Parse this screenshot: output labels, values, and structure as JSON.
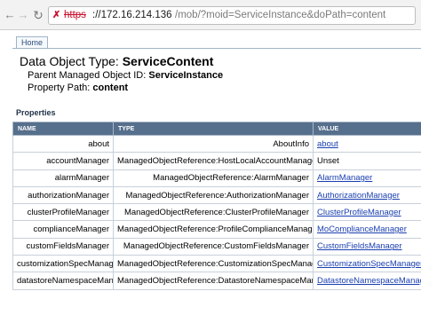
{
  "browser": {
    "back_icon": "back-arrow-icon",
    "forward_icon": "forward-arrow-icon",
    "reload_icon": "reload-icon",
    "security_icon": "insecure-x-icon",
    "url_scheme": "https",
    "url_host": "://172.16.214.136",
    "url_path": "/mob/?moid=ServiceInstance&doPath=content"
  },
  "nav": {
    "home_label": "Home"
  },
  "header": {
    "title_prefix": "Data Object Type: ",
    "title_value": "ServiceContent",
    "parent_label": "Parent Managed Object ID: ",
    "parent_value": "ServiceInstance",
    "path_label": "Property Path: ",
    "path_value": "content"
  },
  "properties": {
    "title": "Properties",
    "columns": [
      "NAME",
      "TYPE",
      "VALUE"
    ],
    "rows": [
      {
        "name": "about",
        "type": "AboutInfo",
        "value": "about",
        "link": true
      },
      {
        "name": "accountManager",
        "type": "ManagedObjectReference:HostLocalAccountManager",
        "value": "Unset",
        "link": false
      },
      {
        "name": "alarmManager",
        "type": "ManagedObjectReference:AlarmManager",
        "value": "AlarmManager",
        "link": true
      },
      {
        "name": "authorizationManager",
        "type": "ManagedObjectReference:AuthorizationManager",
        "value": "AuthorizationManager",
        "link": true
      },
      {
        "name": "clusterProfileManager",
        "type": "ManagedObjectReference:ClusterProfileManager",
        "value": "ClusterProfileManager",
        "link": true
      },
      {
        "name": "complianceManager",
        "type": "ManagedObjectReference:ProfileComplianceManager",
        "value": "MoComplianceManager",
        "link": true
      },
      {
        "name": "customFieldsManager",
        "type": "ManagedObjectReference:CustomFieldsManager",
        "value": "CustomFieldsManager",
        "link": true
      },
      {
        "name": "customizationSpecManager",
        "type": "ManagedObjectReference:CustomizationSpecManager",
        "value": "CustomizationSpecManager",
        "link": true
      },
      {
        "name": "datastoreNamespaceManager",
        "type": "ManagedObjectReference:DatastoreNamespaceManager",
        "value": "DatastoreNamespaceManager",
        "link": true
      }
    ]
  }
}
